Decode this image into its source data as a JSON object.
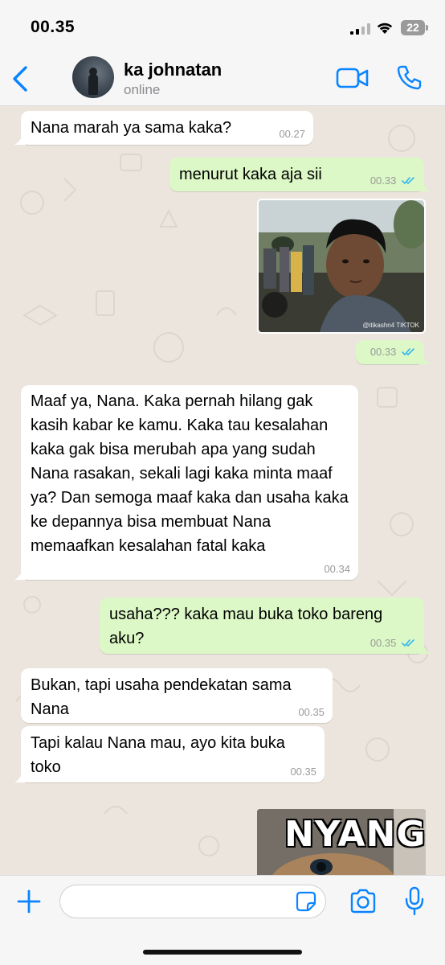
{
  "status_bar": {
    "time": "00.35",
    "battery": "22"
  },
  "header": {
    "contact_name": "ka johnatan",
    "contact_status": "online",
    "icons": [
      "back-chevron-icon",
      "video-call-icon",
      "phone-icon"
    ]
  },
  "messages": [
    {
      "dir": "in",
      "text": "Nana marah ya sama kaka?",
      "time": "00.27"
    },
    {
      "dir": "out",
      "text": "menurut kaka aja sii",
      "time": "00.33",
      "read": true
    },
    {
      "dir": "out",
      "type": "photo",
      "time": "00.33",
      "read": true,
      "caption": "@itikashn4 TIKTOK"
    },
    {
      "dir": "in",
      "text": "Maaf ya, Nana. Kaka pernah hilang gak kasih kabar ke kamu. Kaka tau kesalahan kaka gak bisa merubah apa yang sudah Nana rasakan, sekali lagi kaka minta maaf ya? Dan semoga maaf kaka dan usaha kaka ke depannya bisa membuat Nana memaafkan kesalahan fatal kaka",
      "time": "00.34"
    },
    {
      "dir": "out",
      "text": "usaha??? kaka mau buka toko bareng aku?",
      "time": "00.35",
      "read": true
    },
    {
      "dir": "in",
      "text": "Bukan, tapi usaha pendekatan sama Nana",
      "time": "00.35"
    },
    {
      "dir": "in",
      "text": "Tapi kalau Nana mau, ayo kita buka toko",
      "time": "00.35"
    },
    {
      "dir": "out",
      "type": "sticker",
      "text": "NYANG"
    }
  ],
  "input_bar": {
    "placeholder": "",
    "value": ""
  },
  "colors": {
    "accent": "#0a84ff",
    "incoming_bubble": "#ffffff",
    "outgoing_bubble": "#dcf8c6",
    "chat_background": "#ece5dd",
    "read_ticks": "#34b7f1"
  }
}
